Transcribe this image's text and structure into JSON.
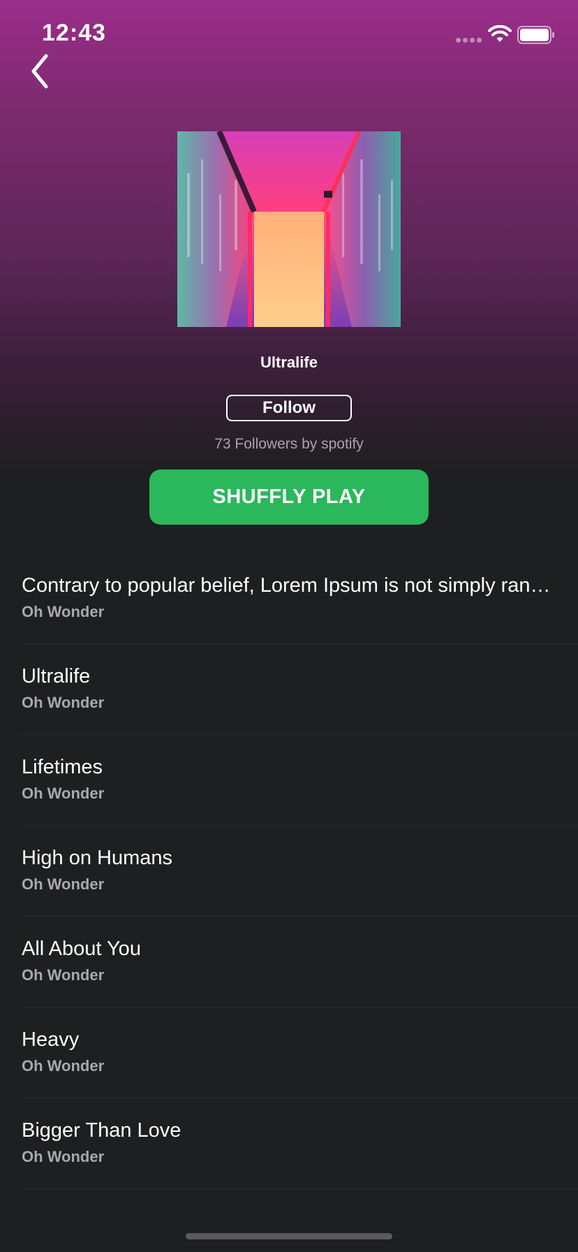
{
  "status_bar": {
    "time": "12:43",
    "icons": [
      "signal-dots-icon",
      "wifi-icon",
      "battery-icon"
    ]
  },
  "nav": {
    "back_icon": "chevron-left-icon"
  },
  "playlist": {
    "title": "Ultralife",
    "follow_label": "Follow",
    "followers_text": "73 Followers by spotify",
    "shuffle_label": "SHUFFLY PLAY",
    "cover_art": "neon-corridor-image"
  },
  "tracks": [
    {
      "title": "Contrary to popular belief, Lorem Ipsum is not simply random text. It has roots",
      "artist": "Oh Wonder"
    },
    {
      "title": "Ultralife",
      "artist": "Oh Wonder"
    },
    {
      "title": "Lifetimes",
      "artist": "Oh Wonder"
    },
    {
      "title": "High on Humans",
      "artist": "Oh Wonder"
    },
    {
      "title": "All About You",
      "artist": "Oh Wonder"
    },
    {
      "title": "Heavy",
      "artist": "Oh Wonder"
    },
    {
      "title": "Bigger Than Love",
      "artist": "Oh Wonder"
    }
  ],
  "colors": {
    "accent_green": "#2bb75b",
    "header_gradient_top": "#9b2d8a",
    "background": "#1e1f21",
    "secondary_text": "#a9a9ad"
  }
}
